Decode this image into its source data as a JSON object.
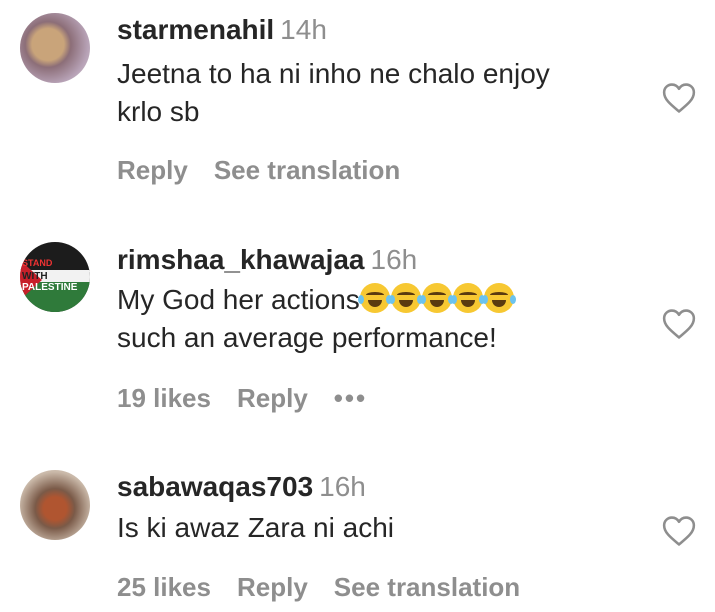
{
  "comments": [
    {
      "username": "starmenahil",
      "time": "14h",
      "text_lines": [
        "Jeetna to ha ni inho ne chalo enjoy",
        "krlo sb"
      ],
      "actions": {
        "reply": "Reply",
        "translation": "See translation"
      }
    },
    {
      "username": "rimshaa_khawajaa",
      "time": "16h",
      "text_lines": [
        "My God her actions",
        "such an average performance!"
      ],
      "emoji_count": 5,
      "emoji": "face-with-tears-of-joy",
      "avatar_text": [
        "STAND",
        "WITH",
        "PALESTINE"
      ],
      "actions": {
        "likes": "19 likes",
        "reply": "Reply",
        "more": "•••"
      }
    },
    {
      "username": "sabawaqas703",
      "time": "16h",
      "text_lines": [
        "Is ki awaz Zara ni achi"
      ],
      "actions": {
        "likes": "25 likes",
        "reply": "Reply",
        "translation": "See translation"
      }
    }
  ],
  "colors": {
    "text": "#262626",
    "muted": "#8e8e8e",
    "background": "#ffffff"
  }
}
